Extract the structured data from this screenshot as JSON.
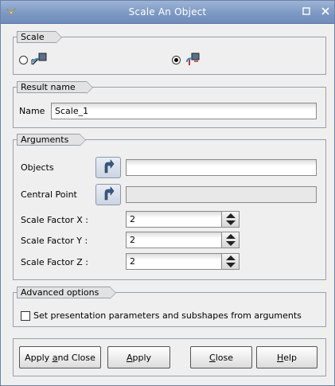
{
  "window": {
    "title": "Scale An Object",
    "icons": {
      "app": "app-icon",
      "maximize": "maximize-icon",
      "close": "close-icon"
    }
  },
  "scale_group": {
    "label": "Scale",
    "options": [
      {
        "icon": "scale-uniform-icon",
        "selected": false
      },
      {
        "icon": "scale-along-axes-icon",
        "selected": true
      }
    ]
  },
  "result_group": {
    "label": "Result name",
    "name_label": "Name",
    "name_value": "Scale_1"
  },
  "arguments_group": {
    "label": "Arguments",
    "objects_label": "Objects",
    "objects_value": "",
    "central_point_label": "Central Point",
    "central_point_value": "",
    "scale_x_label": "Scale Factor X :",
    "scale_x_value": "2",
    "scale_y_label": "Scale Factor Y :",
    "scale_y_value": "2",
    "scale_z_label": "Scale Factor Z :",
    "scale_z_value": "2"
  },
  "advanced_group": {
    "label": "Advanced options",
    "checkbox_label": "Set presentation parameters and subshapes from arguments",
    "checkbox_checked": false
  },
  "buttons": {
    "apply_and_close": {
      "pre": "Apply ",
      "mnemonic": "a",
      "post": "nd Close"
    },
    "apply": {
      "pre": "",
      "mnemonic": "A",
      "post": "pply"
    },
    "close": {
      "pre": "",
      "mnemonic": "C",
      "post": "lose"
    },
    "help": {
      "pre": "",
      "mnemonic": "H",
      "post": "elp"
    }
  }
}
